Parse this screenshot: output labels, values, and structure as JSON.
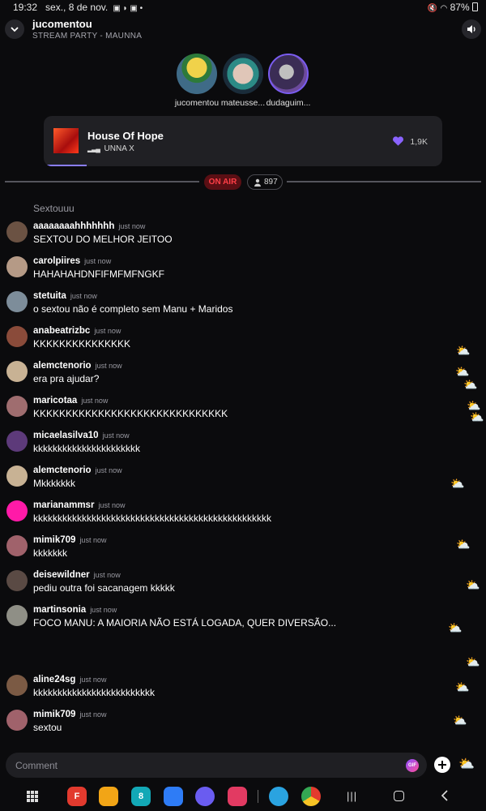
{
  "status_bar": {
    "time": "19:32",
    "date": "sex., 8 de nov.",
    "battery": "87%"
  },
  "header": {
    "title": "jucomentou",
    "subtitle": "STREAM PARTY - MAUNNA"
  },
  "hosts": [
    {
      "name": "jucomentou",
      "color": "#3f6b87"
    },
    {
      "name": "mateusse...",
      "color": "#2c8b86"
    },
    {
      "name": "dudaguim...",
      "color": "#6c4a9c"
    }
  ],
  "player": {
    "song": "House Of Hope",
    "artist": "UNNA X",
    "likes": "1,9K",
    "progress": 0.1
  },
  "live": {
    "badge": "ON AIR",
    "viewers": "897"
  },
  "chat": {
    "partial_message": "Sextouuu",
    "messages": [
      {
        "user": "aaaaaaaahhhhhhh",
        "time": "just now",
        "text": "SEXTOU DO MELHOR JEITOO",
        "avatar": "#6b5243"
      },
      {
        "user": "carolpiires",
        "time": "just now",
        "text": "HAHAHAHDNFIFMFMFNGKF",
        "avatar": "#b59a86"
      },
      {
        "user": "stetuita",
        "time": "just now",
        "text": "o sextou não é completo sem Manu + Maridos",
        "avatar": "#7d8d9a"
      },
      {
        "user": "anabeatrizbc",
        "time": "just now",
        "text": "KKKKKKKKKKKKKKK",
        "avatar": "#8a4b3a"
      },
      {
        "user": "alemctenorio",
        "time": "just now",
        "text": "era pra ajudar?",
        "avatar": "#c8b294"
      },
      {
        "user": "maricotaa",
        "time": "just now",
        "text": "KKKKKKKKKKKKKKKKKKKKKKKKKKKKKK",
        "avatar": "#9f6d6f"
      },
      {
        "user": "micaelasilva10",
        "time": "just now",
        "text": "kkkkkkkkkkkkkkkkkkkkkk",
        "avatar": "#5d3a7a"
      },
      {
        "user": "alemctenorio",
        "time": "just now",
        "text": "Mkkkkkkk",
        "avatar": "#c8b294"
      },
      {
        "user": "marianammsr",
        "time": "just now",
        "text": "kkkkkkkkkkkkkkkkkkkkkkkkkkkkkkkkkkkkkkkkkkkkkkkkk",
        "avatar": "#ff1aa8"
      },
      {
        "user": "mimik709",
        "time": "just now",
        "text": "kkkkkkk",
        "avatar": "#a0626b"
      },
      {
        "user": "deisewildner",
        "time": "just now",
        "text": "pediu outra foi sacanagem kkkkk",
        "avatar": "#5a4a44"
      },
      {
        "user": "martinsonia",
        "time": "just now",
        "text": "FOCO MANU: A MAIORIA NÃO ESTÁ LOGADA, QUER DIVERSÃO...",
        "avatar": "#8f8f86"
      },
      {
        "user": "aline24sg",
        "time": "just now",
        "text": "kkkkkkkkkkkkkkkkkkkkkkkkk",
        "avatar": "#7b5a44"
      },
      {
        "user": "mimik709",
        "time": "just now",
        "text": "sextou",
        "avatar": "#a0626b"
      }
    ]
  },
  "comment": {
    "placeholder": "Comment",
    "gif_label": "GIF"
  },
  "nav_apps": [
    {
      "name": "flipboard",
      "color": "#e23a2e",
      "glyph": "F"
    },
    {
      "name": "files",
      "color": "#f2a516",
      "glyph": ""
    },
    {
      "name": "calendar",
      "color": "#13a8b6",
      "glyph": "8"
    },
    {
      "name": "messages",
      "color": "#2e7cf6",
      "glyph": ""
    },
    {
      "name": "internet",
      "color": "#6a5cf0",
      "glyph": ""
    },
    {
      "name": "screen-recorder",
      "color": "#e23a62",
      "glyph": ""
    },
    {
      "name": "telegram",
      "color": "#2aa3e0",
      "glyph": ""
    },
    {
      "name": "chrome",
      "color": "#ffffff",
      "glyph": ""
    }
  ]
}
